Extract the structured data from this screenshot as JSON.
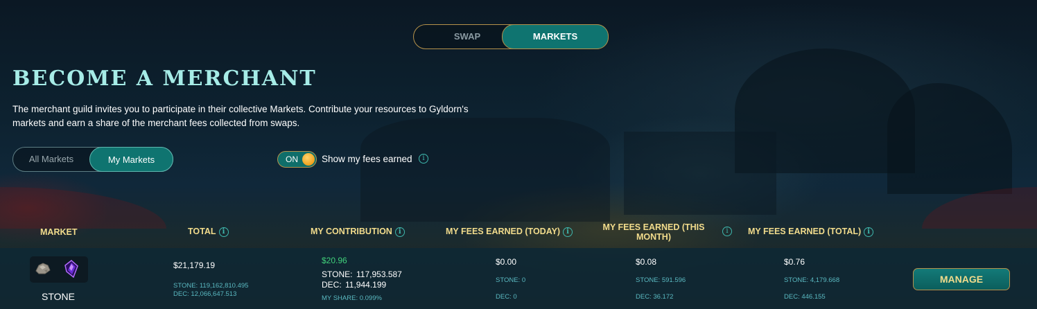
{
  "nav": {
    "swap_label": "SWAP",
    "markets_label": "MARKETS"
  },
  "hero": {
    "title": "BECOME A MERCHANT",
    "description": "The merchant guild invites you to participate in their collective Markets. Contribute your resources to Gyldorn's markets and earn a share of the merchant fees collected from swaps."
  },
  "filters": {
    "all_markets_label": "All Markets",
    "my_markets_label": "My Markets",
    "selected": "My Markets"
  },
  "fees_toggle": {
    "state_label": "ON",
    "label": "Show my fees earned",
    "info_icon": "info-icon"
  },
  "table": {
    "headers": {
      "market": "MARKET",
      "total": "TOTAL",
      "my_contribution": "MY CONTRIBUTION",
      "fees_today": "MY FEES EARNED (TODAY)",
      "fees_month": "MY FEES EARNED (THIS MONTH)",
      "fees_total": "MY FEES EARNED (TOTAL)"
    },
    "rows": [
      {
        "market_name": "STONE",
        "icons": [
          "stone-icon",
          "dec-gem-icon"
        ],
        "total_usd": "$21,179.19",
        "total_stone": "STONE: 119,162,810.495",
        "total_dec": "DEC: 12,066,647.513",
        "contribution_usd": "$20.96",
        "contribution_stone_label": "STONE:",
        "contribution_stone_value": "117,953.587",
        "contribution_dec_label": "DEC:",
        "contribution_dec_value": "11,944.199",
        "my_share": "MY SHARE: 0.099%",
        "today_usd": "$0.00",
        "today_stone": "STONE: 0",
        "today_dec": "DEC: 0",
        "month_usd": "$0.08",
        "month_stone": "STONE: 591.596",
        "month_dec": "DEC: 36.172",
        "alltime_usd": "$0.76",
        "alltime_stone": "STONE: 4,179.668",
        "alltime_dec": "DEC: 446.155",
        "action_label": "MANAGE"
      }
    ]
  },
  "colors": {
    "accent_teal": "#0f7470",
    "gold_border": "#b5924b",
    "header_gold": "#f2dc8c",
    "title_cyan": "#a6ece7",
    "positive_green": "#41d07a"
  }
}
